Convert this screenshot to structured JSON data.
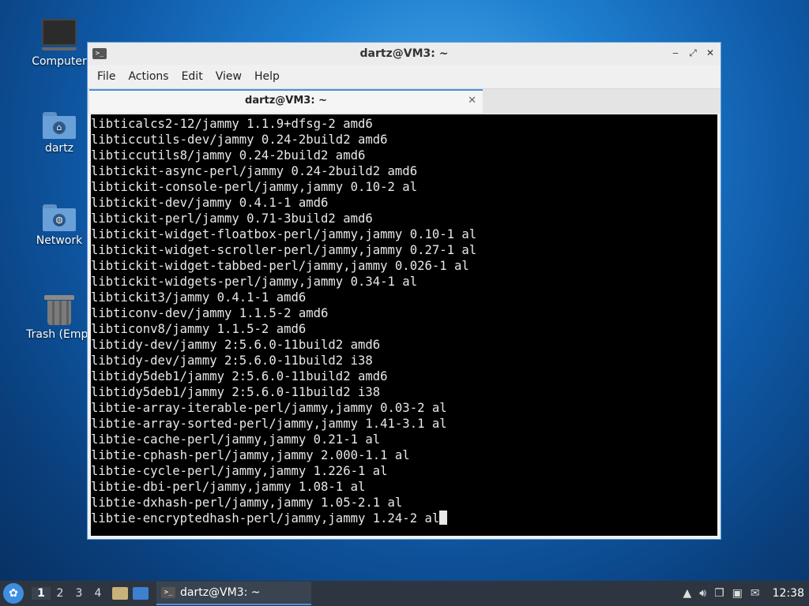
{
  "desktop": {
    "icons": [
      {
        "label": "Computer"
      },
      {
        "label": "dartz"
      },
      {
        "label": "Network"
      },
      {
        "label": "Trash (Empt"
      }
    ]
  },
  "window": {
    "title": "dartz@VM3: ~",
    "menu": [
      "File",
      "Actions",
      "Edit",
      "View",
      "Help"
    ],
    "tab_label": "dartz@VM3: ~",
    "controls": {
      "minimize": "‒",
      "maximize": "⤢",
      "close": "✕"
    },
    "terminal_lines": [
      "libticalcs2-12/jammy 1.1.9+dfsg-2 amd6",
      "libticcutils-dev/jammy 0.24-2build2 amd6",
      "libticcutils8/jammy 0.24-2build2 amd6",
      "libtickit-async-perl/jammy 0.24-2build2 amd6",
      "libtickit-console-perl/jammy,jammy 0.10-2 al",
      "libtickit-dev/jammy 0.4.1-1 amd6",
      "libtickit-perl/jammy 0.71-3build2 amd6",
      "libtickit-widget-floatbox-perl/jammy,jammy 0.10-1 al",
      "libtickit-widget-scroller-perl/jammy,jammy 0.27-1 al",
      "libtickit-widget-tabbed-perl/jammy,jammy 0.026-1 al",
      "libtickit-widgets-perl/jammy,jammy 0.34-1 al",
      "libtickit3/jammy 0.4.1-1 amd6",
      "libticonv-dev/jammy 1.1.5-2 amd6",
      "libticonv8/jammy 1.1.5-2 amd6",
      "libtidy-dev/jammy 2:5.6.0-11build2 amd6",
      "libtidy-dev/jammy 2:5.6.0-11build2 i38",
      "libtidy5deb1/jammy 2:5.6.0-11build2 amd6",
      "libtidy5deb1/jammy 2:5.6.0-11build2 i38",
      "libtie-array-iterable-perl/jammy,jammy 0.03-2 al",
      "libtie-array-sorted-perl/jammy,jammy 1.41-3.1 al",
      "libtie-cache-perl/jammy,jammy 0.21-1 al",
      "libtie-cphash-perl/jammy,jammy 2.000-1.1 al",
      "libtie-cycle-perl/jammy,jammy 1.226-1 al",
      "libtie-dbi-perl/jammy,jammy 1.08-1 al",
      "libtie-dxhash-perl/jammy,jammy 1.05-2.1 al",
      "libtie-encryptedhash-perl/jammy,jammy 1.24-2 al"
    ]
  },
  "taskbar": {
    "workspaces": [
      "1",
      "2",
      "3",
      "4"
    ],
    "active_workspace": "1",
    "task_label": "dartz@VM3: ~",
    "clock": "12:38"
  },
  "icons": {
    "computer": "computer-icon",
    "home_folder": "home-folder-icon",
    "network": "network-icon",
    "trash": "trash-icon",
    "start": "start-menu-icon"
  },
  "colors": {
    "accent": "#4a90d9",
    "terminal_bg": "#000000",
    "taskbar_bg": "#2d3640"
  }
}
